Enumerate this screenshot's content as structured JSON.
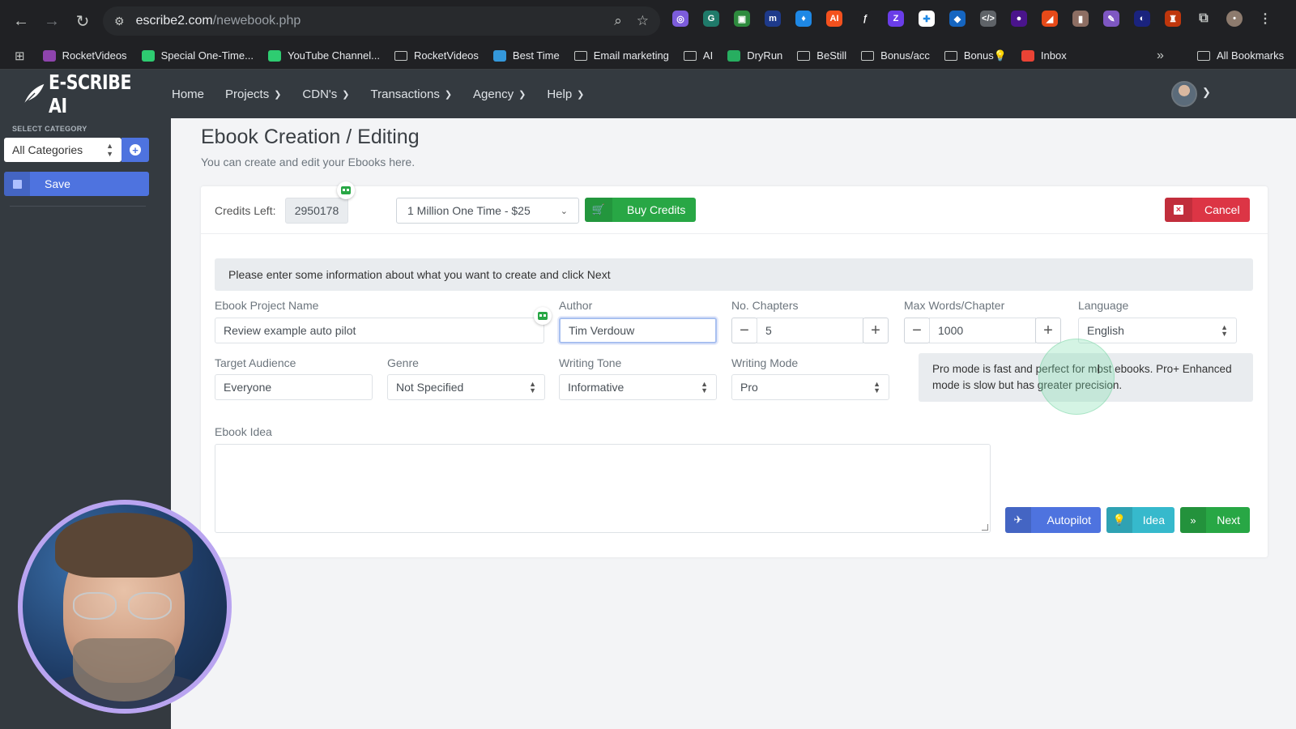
{
  "browser": {
    "url_domain": "escribe2.com",
    "url_path": "/newebook.php",
    "bookmarks": [
      {
        "label": "RocketVideos",
        "type": "link",
        "color": "#8e44ad"
      },
      {
        "label": "Special One-Time...",
        "type": "link",
        "color": "#2ecc71"
      },
      {
        "label": "YouTube Channel...",
        "type": "link",
        "color": "#2ecc71"
      },
      {
        "label": "RocketVideos",
        "type": "folder"
      },
      {
        "label": "Best Time",
        "type": "link",
        "color": "#3498db"
      },
      {
        "label": "Email marketing",
        "type": "folder"
      },
      {
        "label": "AI",
        "type": "folder"
      },
      {
        "label": "DryRun",
        "type": "link",
        "color": "#27ae60"
      },
      {
        "label": "BeStill",
        "type": "folder"
      },
      {
        "label": "Bonus/acc",
        "type": "folder"
      },
      {
        "label": "Bonus💡",
        "type": "folder"
      },
      {
        "label": "Inbox",
        "type": "link",
        "color": "#ea4335"
      }
    ],
    "all_bookmarks": "All Bookmarks",
    "overflow": "»"
  },
  "header": {
    "logo_text": "E-SCRIBE AI",
    "nav": [
      "Home",
      "Projects",
      "CDN's",
      "Transactions",
      "Agency",
      "Help"
    ]
  },
  "sidebar": {
    "section_label": "SELECT CATEGORY",
    "category_value": "All Categories",
    "save_label": "Save"
  },
  "page": {
    "title": "Ebook Creation / Editing",
    "subtitle": "You can create and edit your Ebooks here."
  },
  "credits": {
    "label": "Credits Left:",
    "value": "2950178",
    "package": "1 Million One Time - $25",
    "buy_label": "Buy Credits",
    "cancel_label": "Cancel"
  },
  "form": {
    "info": "Please enter some information about what you want to create and click Next",
    "project_name_label": "Ebook Project Name",
    "project_name_value": "Review example auto pilot",
    "author_label": "Author",
    "author_value": "Tim Verdouw",
    "chapters_label": "No. Chapters",
    "chapters_value": "5",
    "max_words_label": "Max Words/Chapter",
    "max_words_value": "1000",
    "language_label": "Language",
    "language_value": "English",
    "audience_label": "Target Audience",
    "audience_value": "Everyone",
    "genre_label": "Genre",
    "genre_value": "Not Specified",
    "tone_label": "Writing Tone",
    "tone_value": "Informative",
    "mode_label": "Writing Mode",
    "mode_value": "Pro",
    "mode_hint": "Pro mode is fast and perfect for most ebooks. Pro+ Enhanced mode is slow but has greater precision.",
    "idea_label": "Ebook Idea",
    "idea_value": "",
    "autopilot_label": "Autopilot",
    "idea_button_label": "Idea",
    "next_label": "Next"
  },
  "colors": {
    "primary": "#4e73df",
    "success": "#28a745",
    "danger": "#dc3545",
    "info": "#36b9cc",
    "navbar": "#343a40"
  }
}
